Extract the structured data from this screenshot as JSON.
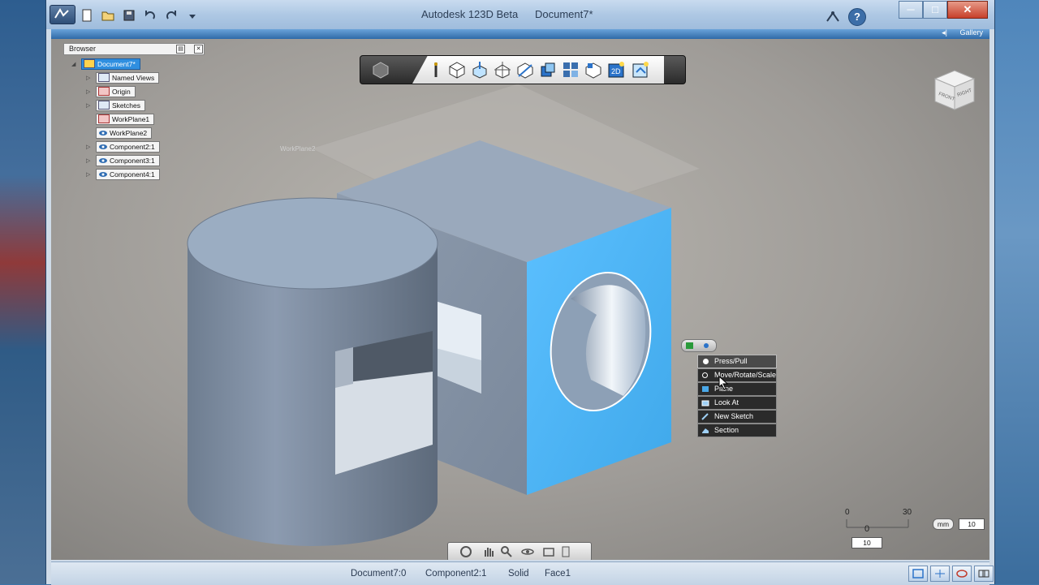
{
  "window": {
    "app_title": "Autodesk 123D Beta",
    "document_title": "Document7*",
    "help_label": "?",
    "minimize_label": "─",
    "maximize_label": "□",
    "close_label": "✕"
  },
  "ribbon": {
    "gallery_label": "Gallery",
    "gallery_arrow": "◂|"
  },
  "browser": {
    "title": "Browser",
    "items": [
      {
        "label": "Document7*",
        "level": 0
      },
      {
        "label": "Named Views",
        "level": 1
      },
      {
        "label": "Origin",
        "level": 1
      },
      {
        "label": "Sketches",
        "level": 1
      },
      {
        "label": "WorkPlane1",
        "level": 1
      },
      {
        "label": "WorkPlane2",
        "level": 1
      },
      {
        "label": "Component2:1",
        "level": 1
      },
      {
        "label": "Component3:1",
        "level": 1
      },
      {
        "label": "Component4:1",
        "level": 1
      }
    ]
  },
  "view_toolbar": {
    "tools": [
      "primitives-icon",
      "sketch-icon",
      "construct-icon",
      "modify-icon",
      "pattern-icon",
      "grouping-icon",
      "combine-icon",
      "snap-icon",
      "measure-icon",
      "2d-icon",
      "material-icon"
    ],
    "badge_2d": "2D"
  },
  "viewcube": {
    "front_label": "FRONT",
    "right_label": "RIGHT"
  },
  "viewport": {
    "workplane_label": "WorkPlane2"
  },
  "marking_menu": {
    "items": [
      {
        "label": "Press/Pull",
        "active": true
      },
      {
        "label": "Move/Rotate/Scale",
        "active": false
      },
      {
        "label": "Plane",
        "active": false
      },
      {
        "label": "Look At",
        "active": false
      },
      {
        "label": "New Sketch",
        "active": false
      },
      {
        "label": "Section",
        "active": false
      }
    ]
  },
  "scale": {
    "left_value": "0",
    "right_value": "30",
    "marker_value": "0",
    "unit": "mm",
    "box_value": "10",
    "bottom_value": "10"
  },
  "status": {
    "document": "Document7:0",
    "component": "Component2:1",
    "type": "Solid",
    "face": "Face1"
  },
  "colors": {
    "selected_face": "#4bb2f2",
    "solid_body": "#8a9bb0",
    "accent": "#2f8fe0"
  }
}
